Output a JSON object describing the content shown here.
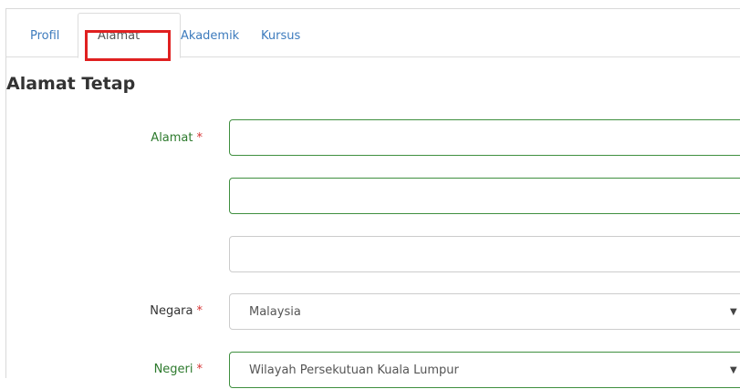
{
  "tabs": [
    {
      "label": "Profil"
    },
    {
      "label": "Alamat"
    },
    {
      "label": "Akademik"
    },
    {
      "label": "Kursus"
    }
  ],
  "section_title": "Alamat Tetap",
  "form": {
    "alamat_label": "Alamat",
    "negara_label": "Negara",
    "negara_value": "Malaysia",
    "negeri_label": "Negeri",
    "negeri_value": "Wilayah Persekutuan Kuala Lumpur",
    "required_marker": "*"
  },
  "colors": {
    "tab_link": "#3d7bbd",
    "valid_label": "#2d7a2d",
    "valid_border": "#3f8f3f",
    "required": "#d63333",
    "highlight": "#e02020"
  },
  "icons": {
    "dropdown": "caret-down-icon"
  }
}
